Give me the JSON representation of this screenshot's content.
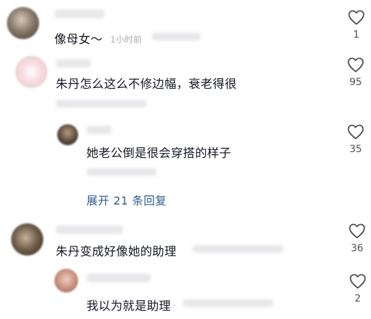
{
  "comments": [
    {
      "text": "像母女～",
      "time": "1小时前",
      "likes": "1",
      "avatar_color": "#8a7a6c"
    },
    {
      "text": "朱丹怎么这么不修边幅，衰老得很",
      "likes": "95",
      "avatar_color": "#f1d6d9"
    },
    {
      "text": "她老公倒是很会穿搭的样子",
      "likes": "35",
      "avatar_color": "#5b4a3c"
    },
    {
      "text": "朱丹变成好像她的助理",
      "likes": "36",
      "avatar_color": "#6d5a46"
    },
    {
      "text": "我以为就是助理",
      "likes": "2",
      "avatar_color": "#c48d7c"
    }
  ],
  "expand_replies": "展开 21 条回复",
  "colors": {
    "text": "#161823",
    "meta": "#a8abb3",
    "link": "#2d5a8e",
    "heart": "#4b4e57"
  }
}
